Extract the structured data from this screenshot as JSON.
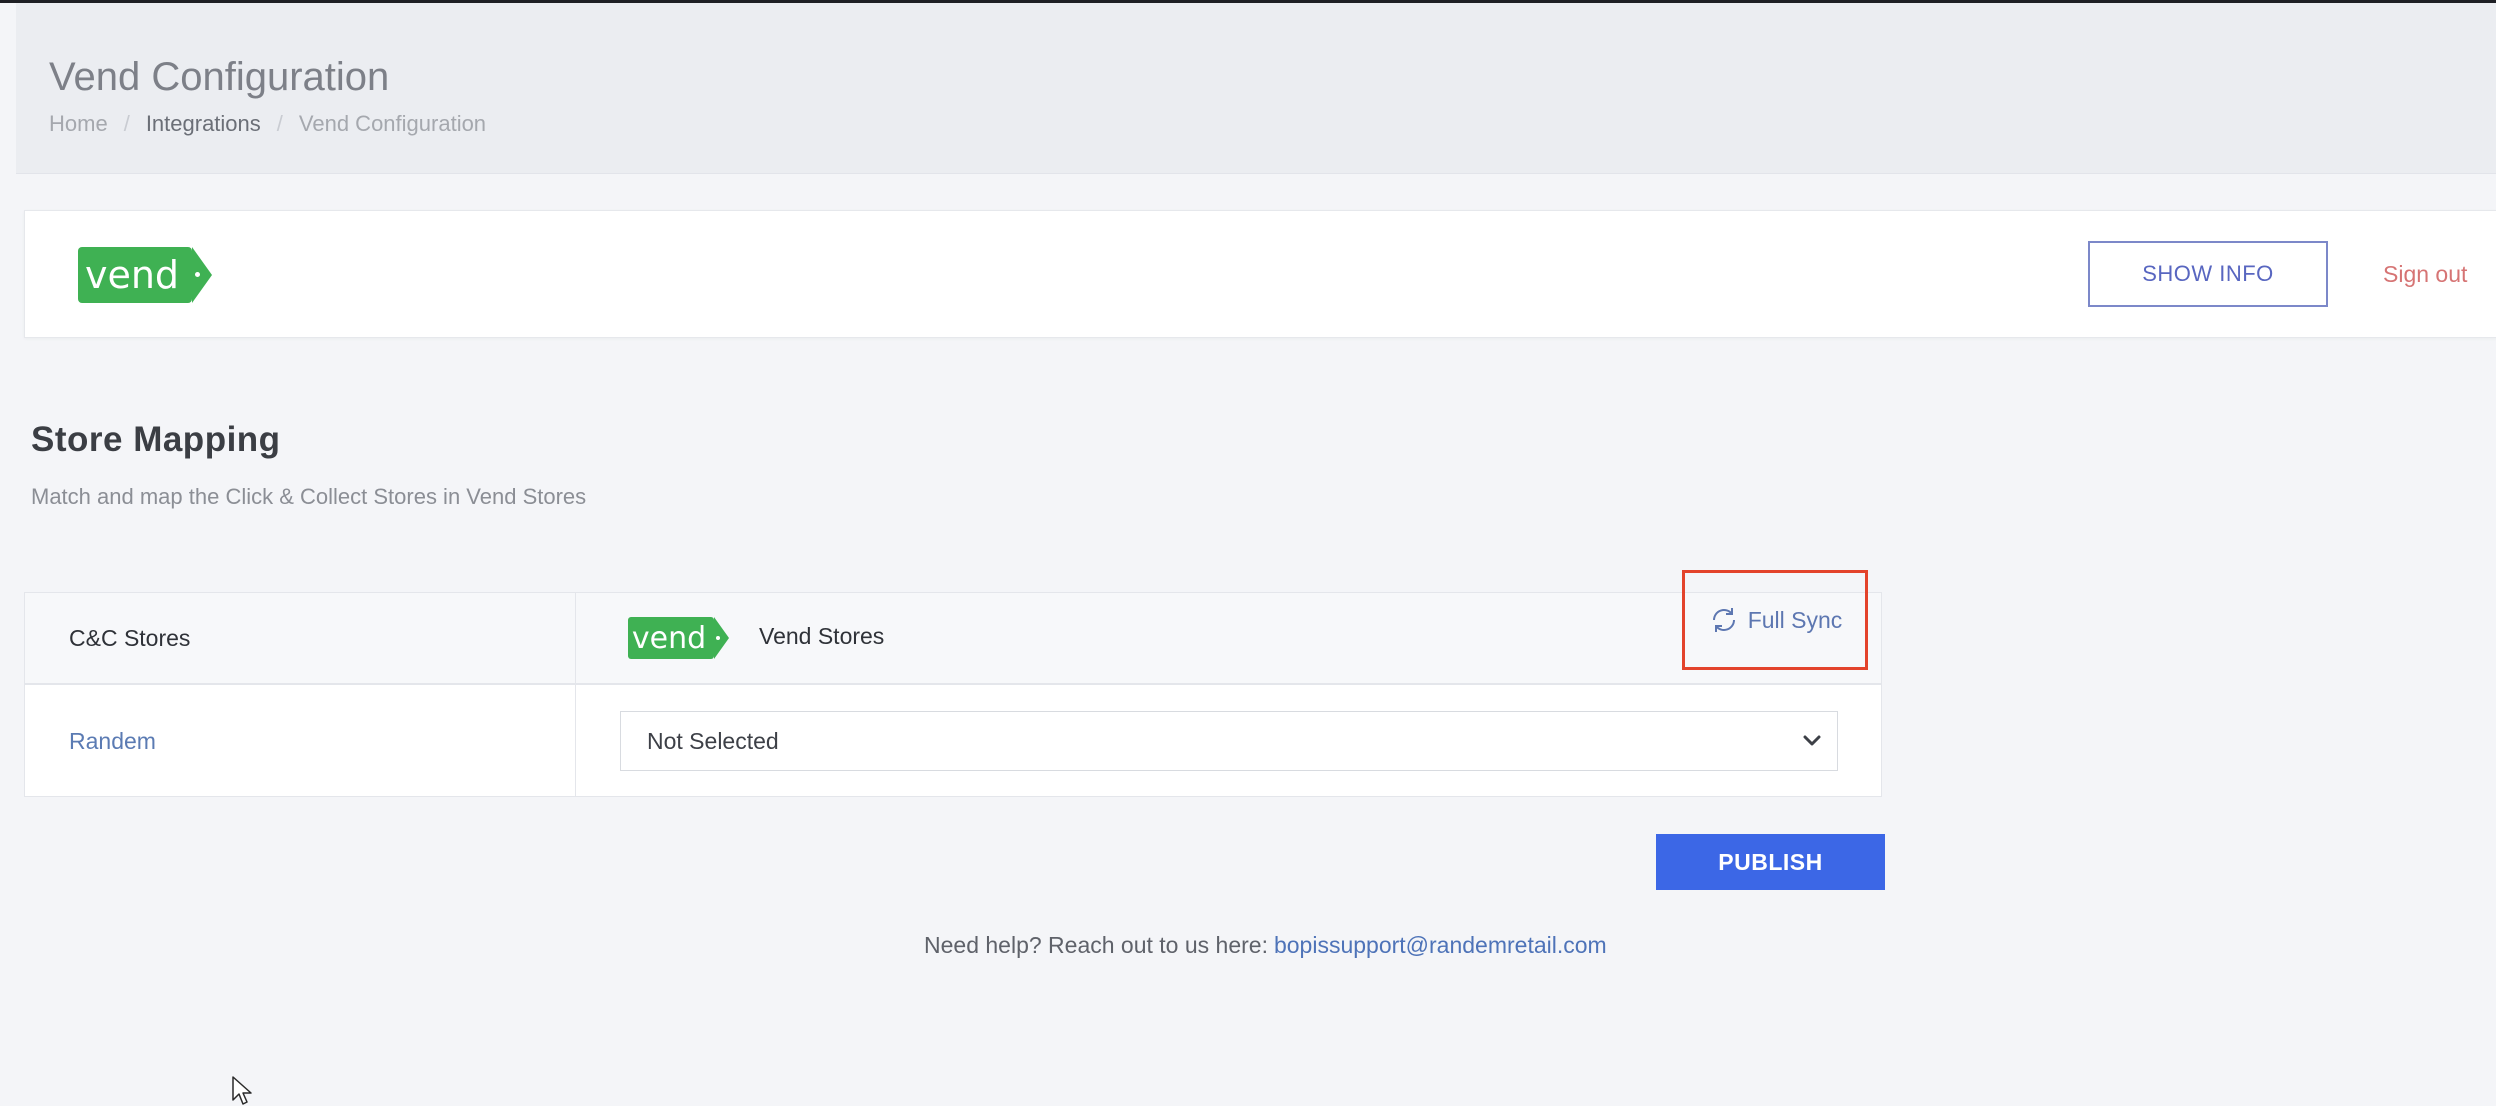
{
  "header": {
    "title": "Vend Configuration",
    "breadcrumb": {
      "home": "Home",
      "integrations": "Integrations",
      "current": "Vend Configuration",
      "separator": "/"
    }
  },
  "vend_card": {
    "logo_text": "vend",
    "show_info_label": "SHOW INFO",
    "sign_out_label": "Sign out"
  },
  "store_mapping": {
    "title": "Store Mapping",
    "subtitle": "Match and map the Click & Collect Stores in Vend Stores",
    "table": {
      "col_cc_header": "C&C Stores",
      "col_vend_logo": "vend",
      "col_vend_header": "Vend Stores",
      "full_sync_label": "Full Sync",
      "rows": [
        {
          "cc_store": "Randem",
          "vend_store": "Not Selected"
        }
      ]
    },
    "publish_label": "PUBLISH"
  },
  "help": {
    "text": "Need help? Reach out to us here:",
    "email": "bopissupport@randemretail.com"
  },
  "colors": {
    "vend_green": "#3fb153",
    "primary_blue": "#3c67e6",
    "highlight_red": "#e3432b",
    "link_blue": "#5b7bb3",
    "sign_out_red": "#d67474"
  },
  "icons": [
    "sync-icon",
    "chevron-down-icon",
    "mouse-cursor-icon"
  ]
}
